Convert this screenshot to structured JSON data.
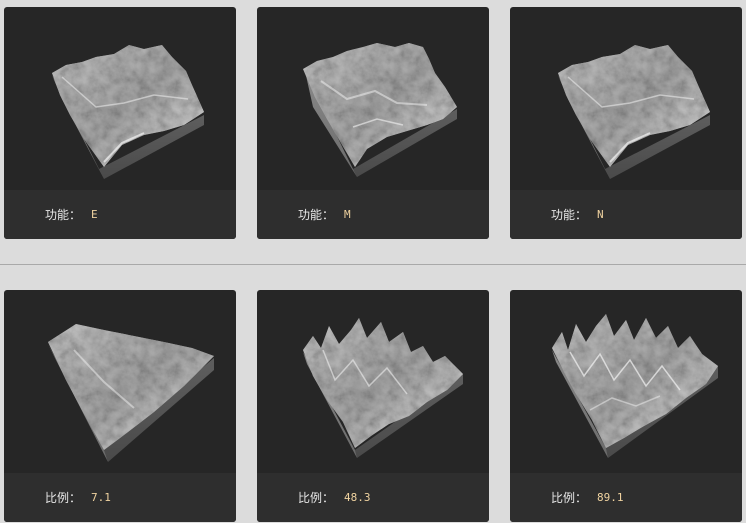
{
  "top_row": [
    {
      "label": "功能：",
      "value": "E"
    },
    {
      "label": "功能：",
      "value": "M"
    },
    {
      "label": "功能：",
      "value": "N"
    }
  ],
  "bottom_row": [
    {
      "label": "比例：",
      "value": "7.1"
    },
    {
      "label": "比例：",
      "value": "48.3"
    },
    {
      "label": "比例：",
      "value": "89.1"
    }
  ],
  "colors": {
    "background": "#dcdcdc",
    "card": "#262626",
    "footer": "#2e2e2e",
    "value_accent": "#f0d3a0",
    "terrain_light": "#d8d8d8",
    "terrain_side": "#5a5a5a"
  }
}
